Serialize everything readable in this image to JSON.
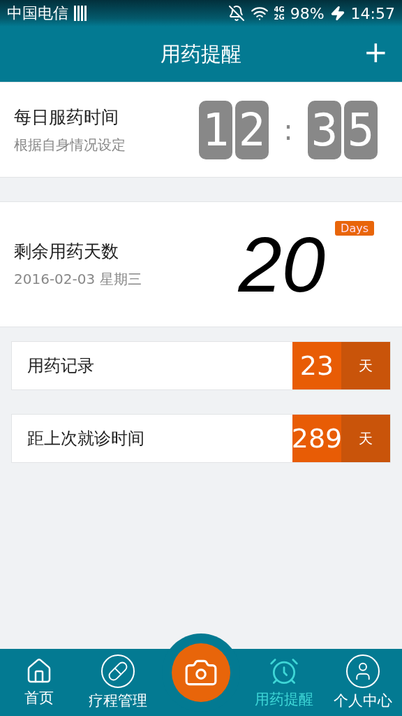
{
  "status_bar": {
    "carrier": "中国电信",
    "network_top": "4G",
    "network_bottom": "2G",
    "battery": "98%",
    "time": "14:57"
  },
  "header": {
    "title": "用药提醒",
    "add": "+"
  },
  "daily_time": {
    "title": "每日服药时间",
    "subtitle": "根据自身情况设定",
    "hour_digits": [
      "1",
      "2"
    ],
    "separator": ":",
    "minute_digits": [
      "3",
      "5"
    ]
  },
  "remaining": {
    "title": "剩余用药天数",
    "date": "2016-02-03 星期三",
    "count": "20",
    "badge": "Days"
  },
  "records": [
    {
      "label": "用药记录",
      "value": "23",
      "unit": "天"
    },
    {
      "label": "距上次就诊时间",
      "value": "289",
      "unit": "天"
    }
  ],
  "nav": [
    {
      "kind": "home",
      "label": "首页",
      "selected": false
    },
    {
      "kind": "pill",
      "label": "疗程管理",
      "selected": false
    },
    {
      "kind": "camera"
    },
    {
      "kind": "alarm",
      "label": "用药提醒",
      "selected": true
    },
    {
      "kind": "user",
      "label": "个人中心",
      "selected": false
    }
  ]
}
